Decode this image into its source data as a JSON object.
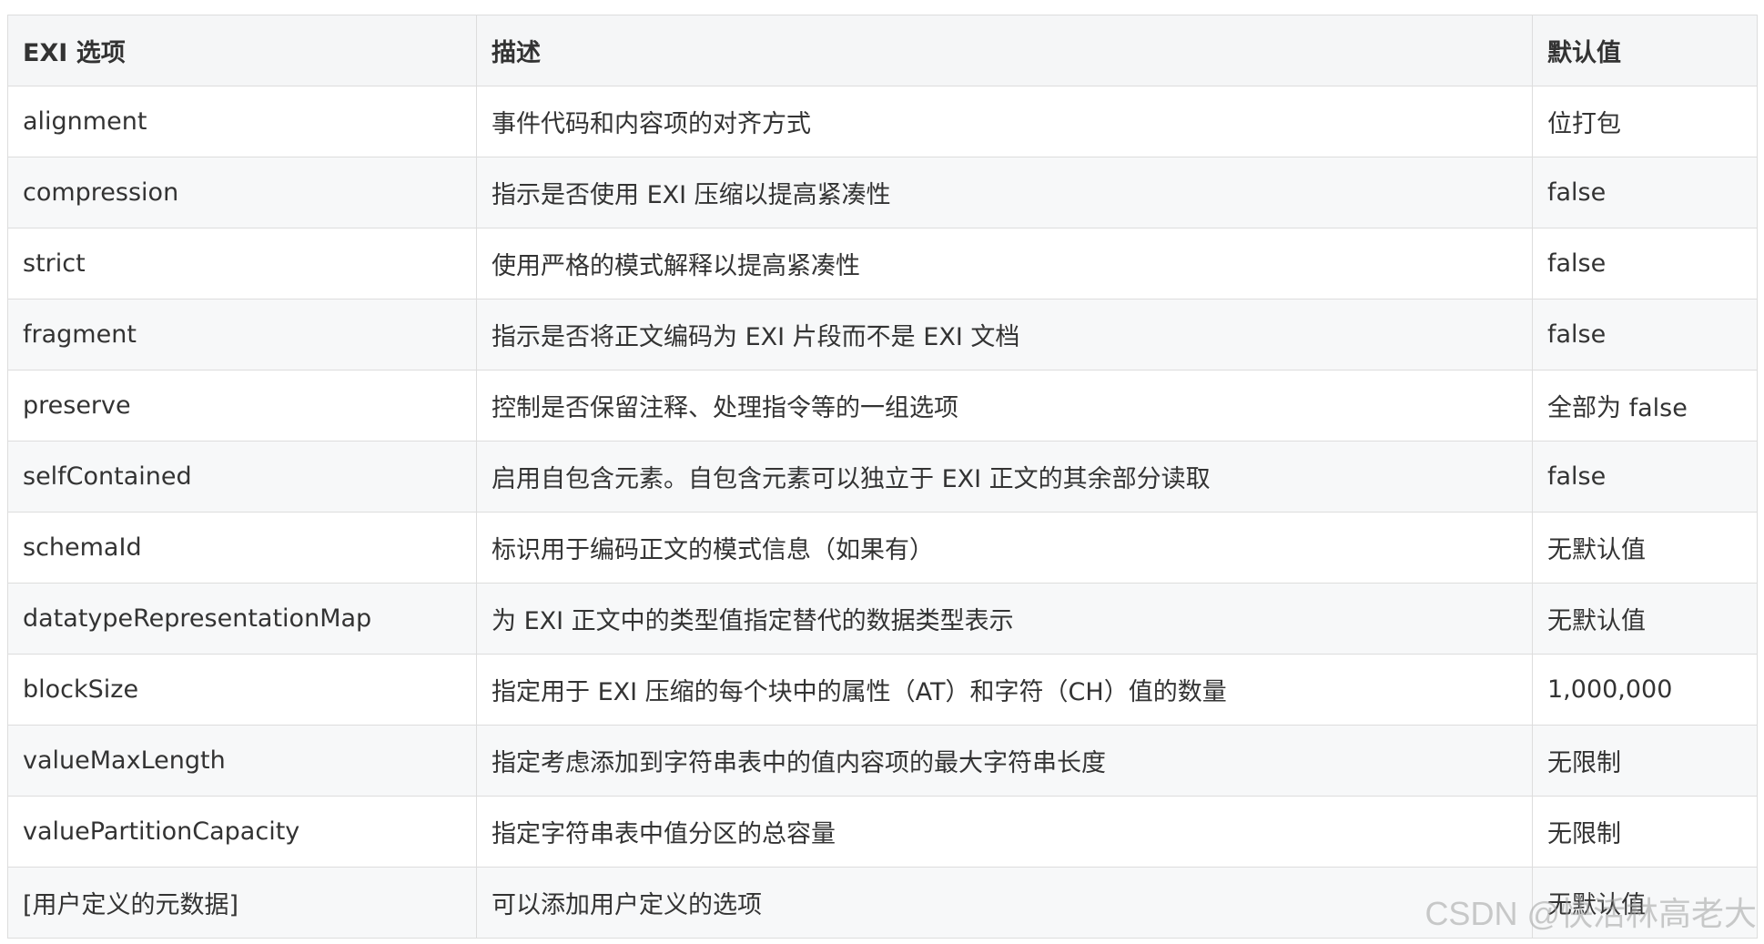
{
  "table": {
    "headers": [
      "EXI 选项",
      "描述",
      "默认值"
    ],
    "rows": [
      [
        "alignment",
        "事件代码和内容项的对齐方式",
        "位打包"
      ],
      [
        "compression",
        "指示是否使用 EXI 压缩以提高紧凑性",
        "false"
      ],
      [
        "strict",
        "使用严格的模式解释以提高紧凑性",
        "false"
      ],
      [
        "fragment",
        "指示是否将正文编码为 EXI 片段而不是 EXI 文档",
        "false"
      ],
      [
        "preserve",
        "控制是否保留注释、处理指令等的一组选项",
        "全部为 false"
      ],
      [
        "selfContained",
        "启用自包含元素。自包含元素可以独立于 EXI 正文的其余部分读取",
        "false"
      ],
      [
        "schemaId",
        "标识用于编码正文的模式信息（如果有）",
        "无默认值"
      ],
      [
        "datatypeRepresentationMap",
        "为 EXI 正文中的类型值指定替代的数据类型表示",
        "无默认值"
      ],
      [
        "blockSize",
        "指定用于 EXI 压缩的每个块中的属性（AT）和字符（CH）值的数量",
        "1,000,000"
      ],
      [
        "valueMaxLength",
        "指定考虑添加到字符串表中的值内容项的最大字符串长度",
        "无限制"
      ],
      [
        "valuePartitionCapacity",
        "指定字符串表中值分区的总容量",
        "无限制"
      ],
      [
        "[用户定义的元数据]",
        "可以添加用户定义的选项",
        "无默认值"
      ]
    ]
  },
  "watermark": "CSDN @快活林高老大"
}
